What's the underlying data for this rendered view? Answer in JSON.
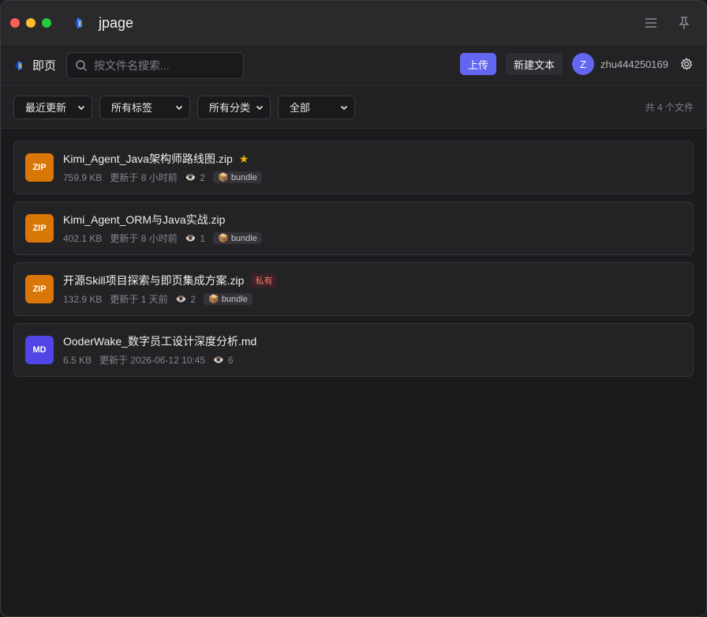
{
  "app": {
    "title": "jpage"
  },
  "header": {
    "brand": "即页",
    "search_placeholder": "按文件名搜索...",
    "upload_label": "上传",
    "new_text_label": "新建文本",
    "avatar_letter": "Z",
    "username": "zhu444250169"
  },
  "filters": {
    "sort": "最近更新",
    "tags": "所有标签",
    "categories": "所有分类",
    "scope": "全部",
    "count": "共 4 个文件"
  },
  "files": [
    {
      "type": "ZIP",
      "type_color": "#d97706",
      "name": "Kimi_Agent_Java架构师路线图.zip",
      "starred": "★",
      "private": "",
      "size": "759.9 KB",
      "updated": "更新于 8 小时前",
      "views": "2",
      "tag": "bundle"
    },
    {
      "type": "ZIP",
      "type_color": "#d97706",
      "name": "Kimi_Agent_ORM与Java实战.zip",
      "starred": "",
      "private": "",
      "size": "402.1 KB",
      "updated": "更新于 8 小时前",
      "views": "1",
      "tag": "bundle"
    },
    {
      "type": "ZIP",
      "type_color": "#d97706",
      "name": "开源Skill项目探索与即页集成方案.zip",
      "starred": "",
      "private": "私有",
      "size": "132.9 KB",
      "updated": "更新于 1 天前",
      "views": "2",
      "tag": "bundle"
    },
    {
      "type": "MD",
      "type_color": "#4f46e5",
      "name": "OoderWake_数字员工设计深度分析.md",
      "starred": "",
      "private": "",
      "size": "6.5 KB",
      "updated": "更新于 2026-06-12 10:45",
      "views": "6",
      "tag": ""
    }
  ],
  "icons": {
    "eye": "eye-icon",
    "package": "package-icon"
  },
  "colors": {
    "accent": "#6366f1",
    "zip": "#d97706",
    "md": "#4f46e5"
  }
}
